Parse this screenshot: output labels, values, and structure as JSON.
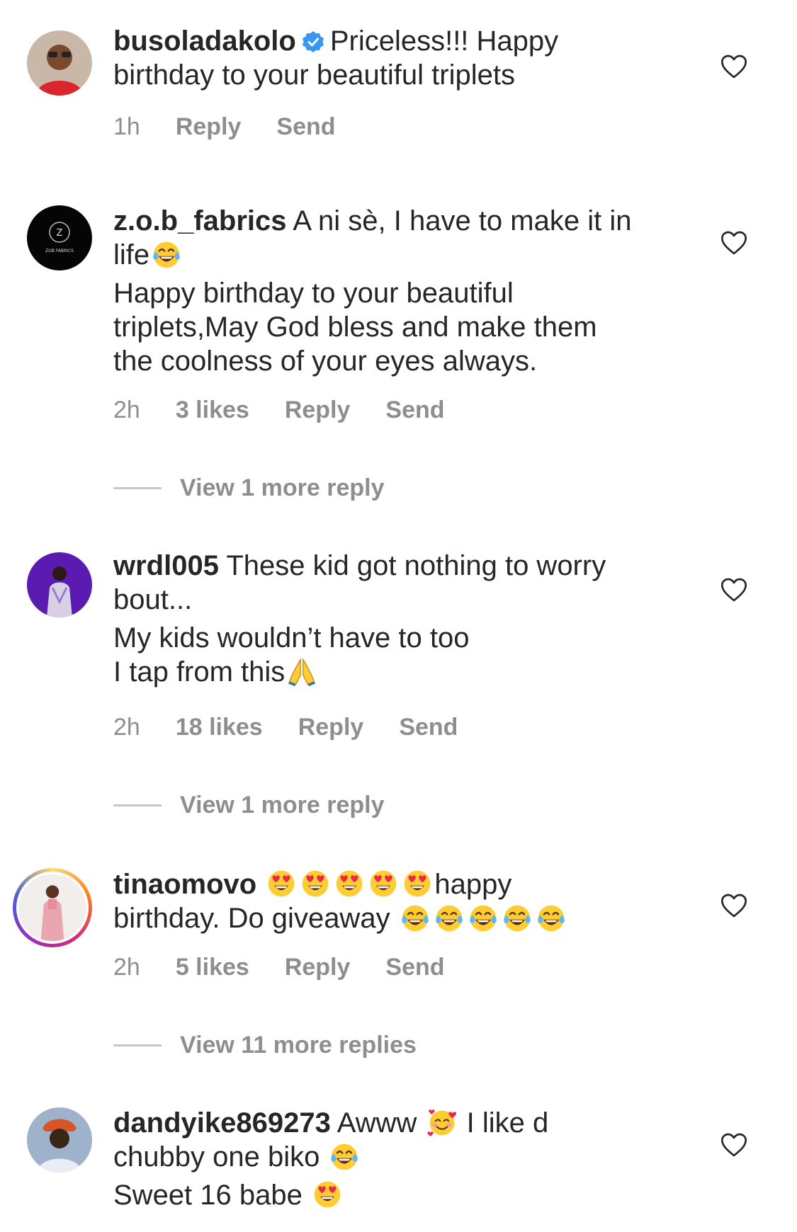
{
  "comments": [
    {
      "username": "busoladakolo",
      "verified": true,
      "text_lines": [
        "Priceless!!! Happy",
        "birthday to your beautiful triplets"
      ],
      "time": "1h",
      "likes": "",
      "reply_label": "Reply",
      "send_label": "Send",
      "view_more": ""
    },
    {
      "username": "z.o.b_fabrics",
      "text_lines": [
        "A ni sè, I have to make it in",
        "life",
        "Happy birthday to your beautiful",
        "triplets,May God bless and make them",
        "the coolness of your eyes always."
      ],
      "avatar_text": "ZOB FABRICS",
      "time": "2h",
      "likes": "3 likes",
      "reply_label": "Reply",
      "send_label": "Send",
      "view_more": "View 1 more reply"
    },
    {
      "username": "wrdl005",
      "text_lines": [
        "These kid got nothing to worry",
        "bout...",
        "My kids wouldn’t have to too",
        "I tap from this"
      ],
      "time": "2h",
      "likes": "18 likes",
      "reply_label": "Reply",
      "send_label": "Send",
      "view_more": "View 1 more reply"
    },
    {
      "username": "tinaomovo",
      "text_lines": [
        "happy",
        "birthday. Do giveaway"
      ],
      "time": "2h",
      "likes": "5 likes",
      "reply_label": "Reply",
      "send_label": "Send",
      "view_more": "View 11 more replies"
    },
    {
      "username": "dandyike869273",
      "text_lines": [
        "Awww",
        "I like d",
        "chubby one biko",
        "Sweet 16 babe"
      ],
      "time": "",
      "likes": "",
      "reply_label": "",
      "send_label": "",
      "view_more": ""
    }
  ],
  "icons": {
    "like": "heart-outline-icon",
    "verified": "verified-badge-icon",
    "emoji_laugh": "face-with-tears-of-joy",
    "emoji_heart_eyes": "smiling-face-with-heart-eyes",
    "emoji_pray": "folded-hands",
    "emoji_hearts": "smiling-face-with-hearts"
  },
  "colors": {
    "text": "#262626",
    "secondary": "#8e8e8e",
    "verified": "#3897f0"
  }
}
